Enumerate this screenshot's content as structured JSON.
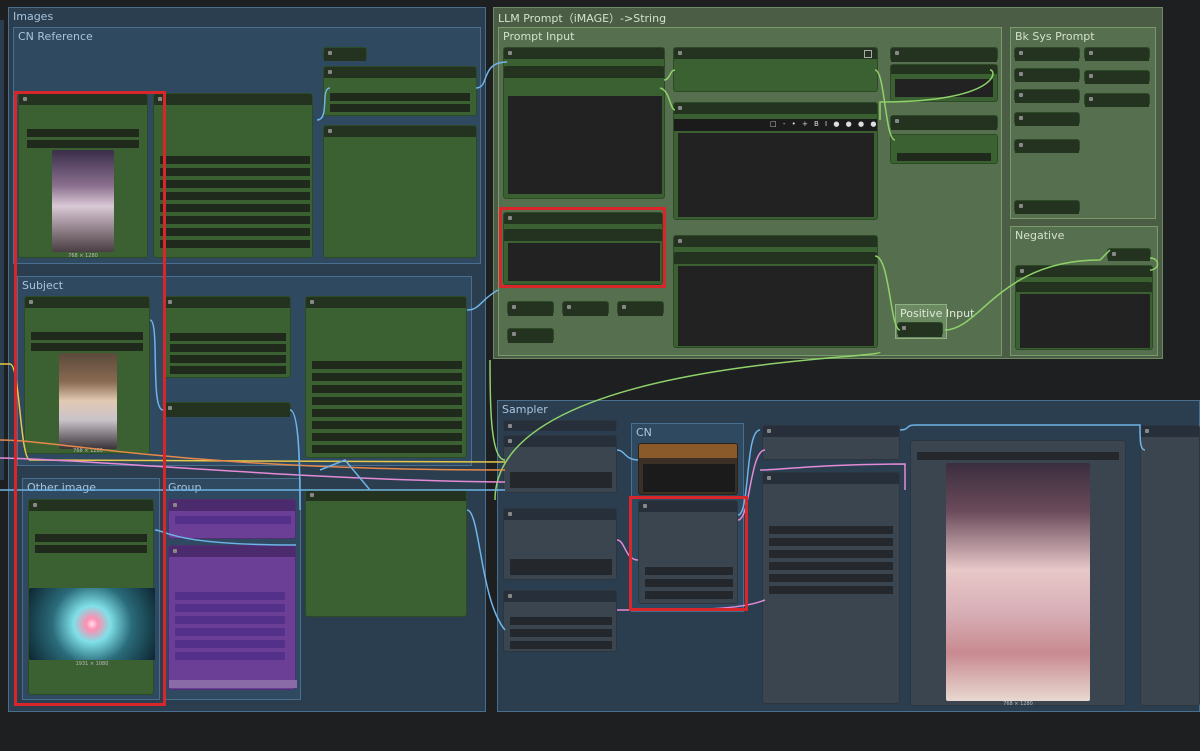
{
  "groups": {
    "images": "Images",
    "cn_reference": "CN Reference",
    "subject": "Subject",
    "other_image": "Other image",
    "group": "Group",
    "llm_prompt": "LLM Prompt（iMAGE）->String",
    "prompt_input": "Prompt Input",
    "bk_sys_prompt": "Bk Sys Prompt",
    "negative": "Negative",
    "positive_input": "Positive Input",
    "sampler": "Sampler",
    "cn": "CN"
  },
  "image_captions": {
    "cn_reference": "768 × 1280",
    "subject": "768 × 1280",
    "other_image": "1931 × 1080",
    "preview": "768 × 1280"
  },
  "toolbar": {
    "text_editor_icons": [
      "□",
      "-",
      "-",
      "+",
      "B",
      "I",
      "●",
      "●",
      "●",
      "●"
    ]
  },
  "colors": {
    "background": "#1e1f21",
    "group_border": "#4a6f8e",
    "node_green": "#3b6133",
    "node_gray": "#3a4550",
    "node_purple": "#6a3f95",
    "highlight_red": "#d9262a",
    "wire_blue": "#6fb4e8",
    "wire_green": "#8fd26a",
    "wire_yellow": "#e6c84a",
    "wire_pink": "#e58ad6",
    "wire_orange": "#e6894a"
  }
}
